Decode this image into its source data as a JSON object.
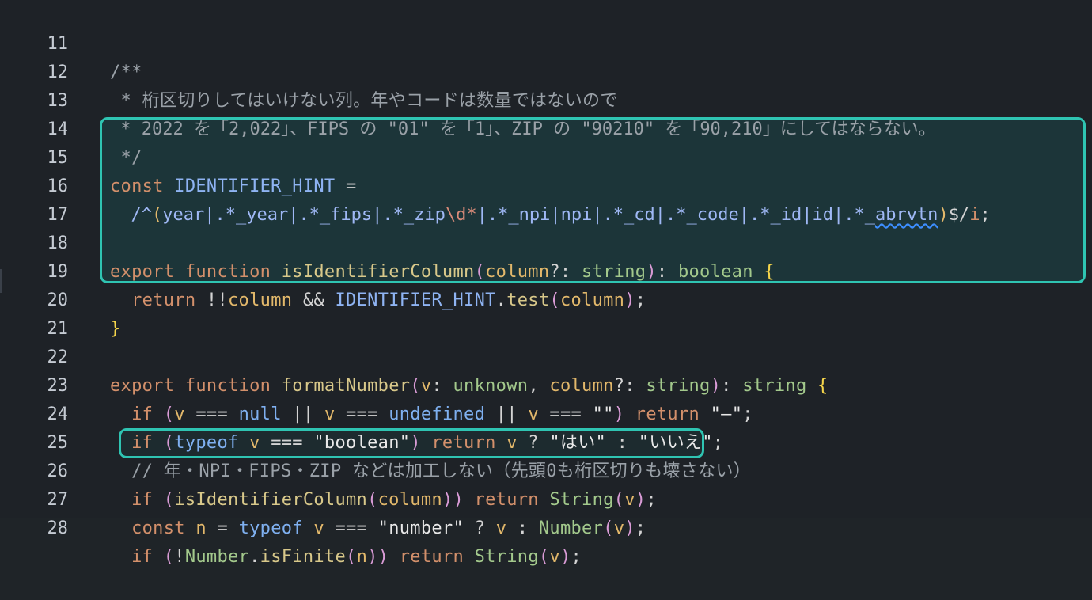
{
  "editor": {
    "theme_colors": {
      "background": "#1e2227",
      "highlight_border": "#2fc4b2",
      "keyword": "#d3906b",
      "function": "#d8c88a",
      "identifier": "#8fb4f3",
      "type": "#a3c98c",
      "comment": "#9aa1a8"
    },
    "lines": [
      {
        "num": "11",
        "text": "/**"
      },
      {
        "num": "12",
        "text": " * 桁区切りしてはいけない列。年やコードは数量ではないので"
      },
      {
        "num": "13",
        "text": " * 2022 を「2,022」、FIPS の \"01\" を「1」、ZIP の \"90210\" を「90,210」にしてはならない。"
      },
      {
        "num": "14",
        "text": " */"
      },
      {
        "num": "15",
        "k1": "const",
        "id1": "IDENTIFIER_HINT",
        "rest": " ="
      },
      {
        "num": "16",
        "r1": "/^",
        "r2": "(",
        "r3": "year",
        "r4": "|.*_year|.*_fips|.*_zip",
        "r5": "\\d*",
        "r6": "|.*_npi|npi|.*_cd|.*_code|.*_id|id|.*_",
        "r7": "abrvtn",
        "r8": ")",
        "r9": "$/",
        "r10": "i",
        "r11": ";"
      },
      {
        "num": "17"
      },
      {
        "num": "18",
        "k1": "export",
        "k2": "function",
        "fn": "isIdentifierColumn",
        "p1": "(",
        "param": "column",
        "q": "?: ",
        "type": "string",
        "p2": ")",
        "colon": ": ",
        "ret": "boolean",
        "brace": "{"
      },
      {
        "num": "19",
        "k1": "return",
        "op1": " !!",
        "a": "column",
        "op2": " && ",
        "id1": "IDENTIFIER_HINT",
        "dot": ".",
        "fn": "test",
        "p1": "(",
        "a2": "column",
        "p2": ")",
        "semi": ";"
      },
      {
        "num": "20",
        "brace": "}"
      },
      {
        "num": "21"
      },
      {
        "num": "22",
        "k1": "export",
        "k2": "function",
        "fn": "formatNumber",
        "p1": "(",
        "param1": "v",
        "c1": ": ",
        "t1": "unknown",
        "comma": ", ",
        "param2": "column",
        "q": "?: ",
        "t2": "string",
        "p2": ")",
        "colon": ": ",
        "ret": "string",
        "brace": "{"
      },
      {
        "num": "23",
        "k1": "if",
        "p1": " (",
        "a": "v",
        "op": " === ",
        "n1": "null",
        "or1": " || ",
        "a2": "v",
        "op2": " === ",
        "n2": "undefined",
        "or2": " || ",
        "a3": "v",
        "op3": " === ",
        "s": "\"\"",
        "p2": ")",
        "k2": " return",
        "s2": " \"—\"",
        "semi": ";"
      },
      {
        "num": "24",
        "k1": "if",
        "p1": " (",
        "kw": "typeof",
        "a": " v",
        "op": " === ",
        "s": "\"boolean\"",
        "p2": ")",
        "k2": " return",
        "a2": " v",
        "op2": " ? ",
        "s2": "\"はい\"",
        "op3": " : ",
        "s3": "\"いいえ\"",
        "semi": ";"
      },
      {
        "num": "25",
        "text": "// 年・NPI・FIPS・ZIP などは加工しない（先頭0も桁区切りも壊さない）"
      },
      {
        "num": "26",
        "k1": "if",
        "p1": " (",
        "fn": "isIdentifierColumn",
        "p2": "(",
        "a": "column",
        "p3": "))",
        "k2": " return",
        "fn2": " String",
        "p4": "(",
        "a2": "v",
        "p5": ")",
        "semi": ";"
      },
      {
        "num": "27",
        "k1": "const",
        "a": " n",
        "op": " = ",
        "kw": "typeof",
        "a2": " v",
        "op2": " === ",
        "s": "\"number\"",
        "op3": " ? ",
        "a3": "v",
        "op4": " : ",
        "fn": "Number",
        "p1": "(",
        "a4": "v",
        "p2": ")",
        "semi": ";"
      },
      {
        "num": "28",
        "k1": "if",
        "p1": " (",
        "op": "!",
        "fn": "Number",
        "dot": ".",
        "fn2": "isFinite",
        "p2": "(",
        "a": "n",
        "p3": "))",
        "k2": " return",
        "fn3": " String",
        "p4": "(",
        "a2": "v",
        "p5": ")",
        "semi": ";"
      }
    ]
  }
}
